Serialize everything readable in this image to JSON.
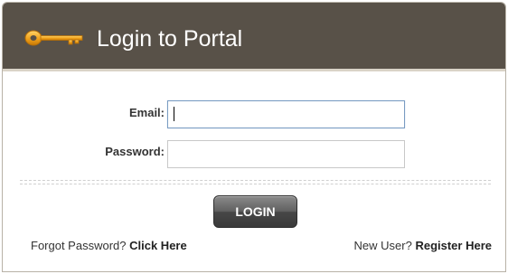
{
  "header": {
    "title": "Login to Portal",
    "icon": "key-icon",
    "background": "#585148"
  },
  "form": {
    "email_label": "Email:",
    "email_value": "",
    "password_label": "Password:",
    "password_value": ""
  },
  "actions": {
    "login_label": "LOGIN"
  },
  "footer": {
    "forgot_text": "Forgot Password?",
    "forgot_link": "Click Here",
    "new_user_text": "New User?",
    "register_link": "Register Here"
  }
}
